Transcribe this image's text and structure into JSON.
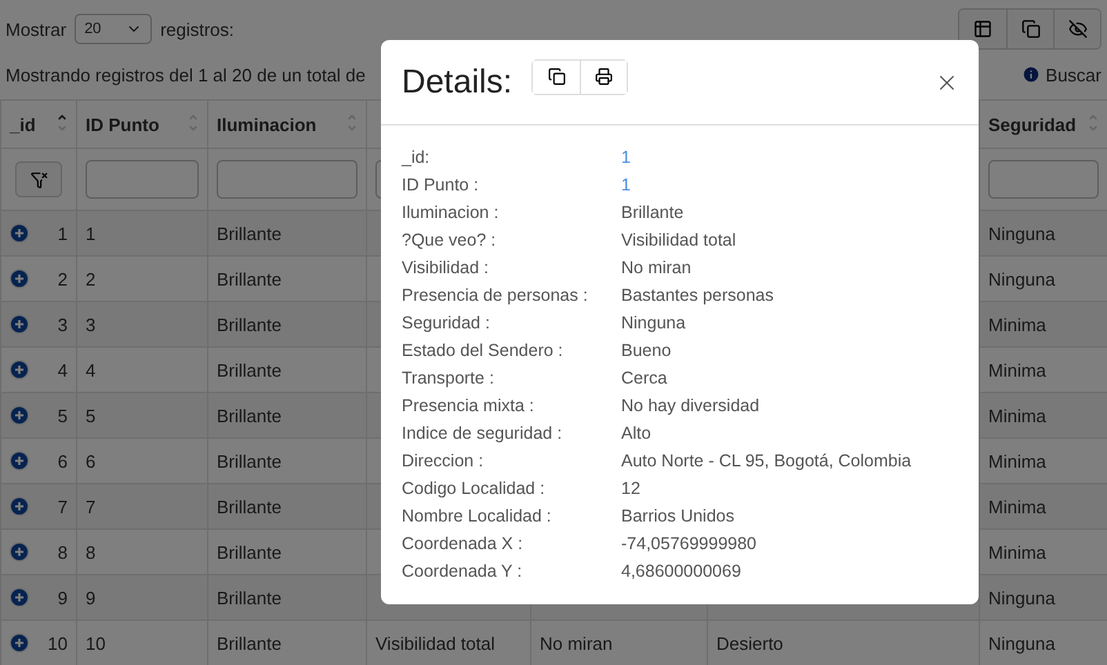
{
  "toolbar": {
    "show_label": "Mostrar",
    "page_size": "20",
    "records_label": "registros:"
  },
  "info": "Mostrando registros del 1 al 20 de un total de",
  "search_label": "Buscar",
  "table": {
    "columns": [
      {
        "label": "_id",
        "sorted": true
      },
      {
        "label": "ID Punto",
        "sorted": false
      },
      {
        "label": "Iluminacion",
        "sorted": false
      },
      {},
      {},
      {},
      {
        "label": "Seguridad",
        "sorted": false
      }
    ],
    "rows": [
      {
        "cells": [
          "1",
          "1",
          "Brillante",
          null,
          null,
          null,
          "Ninguna"
        ]
      },
      {
        "cells": [
          "2",
          "2",
          "Brillante",
          null,
          null,
          null,
          "Ninguna"
        ]
      },
      {
        "cells": [
          "3",
          "3",
          "Brillante",
          null,
          null,
          null,
          "Minima"
        ]
      },
      {
        "cells": [
          "4",
          "4",
          "Brillante",
          null,
          null,
          null,
          "Minima"
        ]
      },
      {
        "cells": [
          "5",
          "5",
          "Brillante",
          null,
          null,
          null,
          "Minima"
        ]
      },
      {
        "cells": [
          "6",
          "6",
          "Brillante",
          null,
          null,
          null,
          "Minima"
        ]
      },
      {
        "cells": [
          "7",
          "7",
          "Brillante",
          null,
          null,
          null,
          "Minima"
        ]
      },
      {
        "cells": [
          "8",
          "8",
          "Brillante",
          null,
          null,
          null,
          "Minima"
        ]
      },
      {
        "cells": [
          "9",
          "9",
          "Brillante",
          null,
          null,
          null,
          "Ninguna"
        ]
      },
      {
        "cells": [
          "10",
          "10",
          "Brillante",
          "Visibilidad total",
          "No miran",
          "Desierto",
          "Ninguna"
        ]
      }
    ]
  },
  "modal": {
    "title": "Details:",
    "fields": [
      {
        "label": "_id:",
        "value": "1",
        "kind": "link"
      },
      {
        "label": "ID Punto :",
        "value": "1",
        "kind": "link"
      },
      {
        "label": "Iluminacion :",
        "value": "Brillante",
        "kind": "text"
      },
      {
        "label": "?Que veo? :",
        "value": "Visibilidad total",
        "kind": "text"
      },
      {
        "label": "Visibilidad :",
        "value": "No miran",
        "kind": "text"
      },
      {
        "label": "Presencia de personas :",
        "value": "Bastantes personas",
        "kind": "text"
      },
      {
        "label": "Seguridad :",
        "value": "Ninguna",
        "kind": "text"
      },
      {
        "label": "Estado del Sendero :",
        "value": "Bueno",
        "kind": "text"
      },
      {
        "label": "Transporte :",
        "value": "Cerca",
        "kind": "text"
      },
      {
        "label": "Presencia mixta :",
        "value": "No hay diversidad",
        "kind": "text"
      },
      {
        "label": "Indice de seguridad :",
        "value": "Alto",
        "kind": "text"
      },
      {
        "label": "Direccion :",
        "value": "Auto Norte - CL 95, Bogotá, Colombia",
        "kind": "text"
      },
      {
        "label": "Codigo Localidad :",
        "value": "12",
        "kind": "text"
      },
      {
        "label": "Nombre Localidad :",
        "value": "Barrios Unidos",
        "kind": "text"
      },
      {
        "label": "Coordenada X :",
        "value": "-74,05769999980",
        "kind": "text"
      },
      {
        "label": "Coordenada Y :",
        "value": "4,68600000069",
        "kind": "text"
      }
    ]
  }
}
